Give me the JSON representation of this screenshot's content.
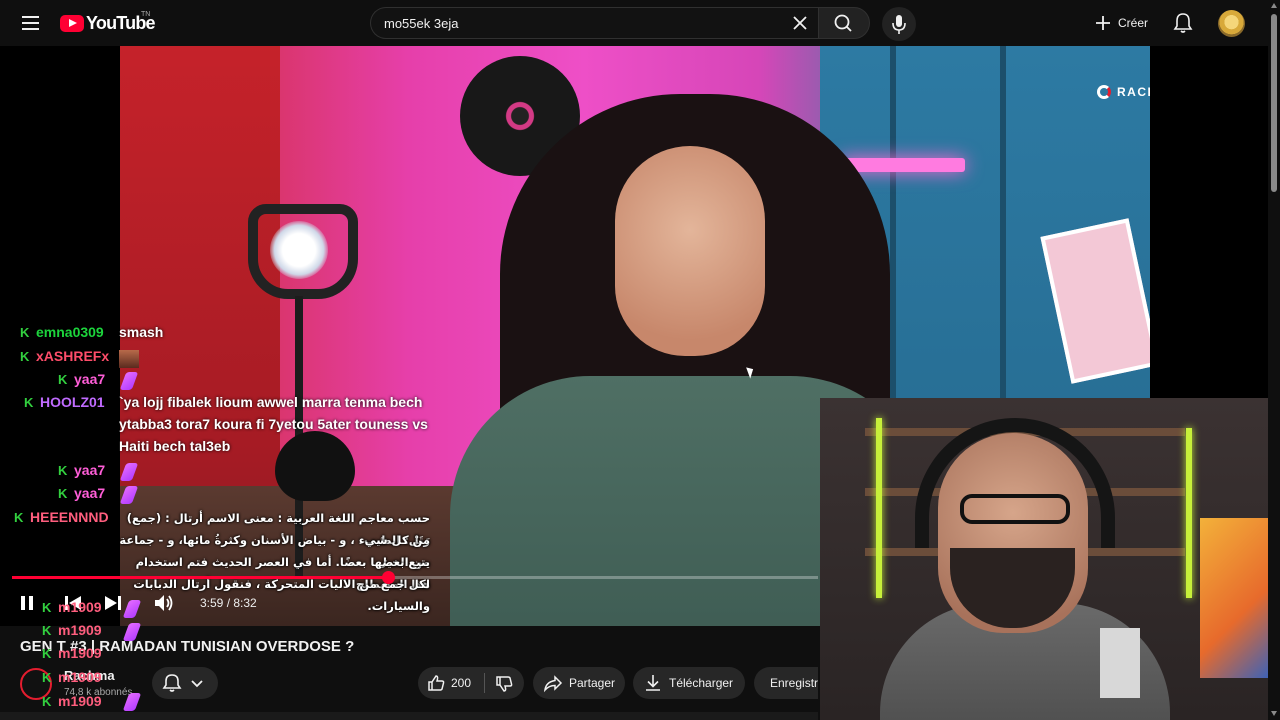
{
  "header": {
    "logo_text": "YouTube",
    "logo_country": "TN",
    "search_value": "mo55ek 3eja",
    "create_label": "Créer"
  },
  "video": {
    "brand_overlay": "RACHMA",
    "current_time": "3:59",
    "duration": "8:32",
    "time_display": "3:59 / 8:32",
    "progress_fraction": 0.467
  },
  "chat": {
    "messages": [
      {
        "user": "emna0309",
        "text": "smash",
        "emote": ""
      },
      {
        "user": "xASHREFx",
        "text": "",
        "emote": "picture"
      },
      {
        "user": "yaa7",
        "text": "",
        "emote": "zap"
      },
      {
        "user": "HOOLZ01",
        "text": "`ya lojj fibalek lioum awwel marra tenma bech",
        "emote": ""
      },
      {
        "user": "",
        "text": "ytabba3 tora7 koura fi 7yetou 5ater touness vs",
        "emote": ""
      },
      {
        "user": "",
        "text": "Haiti bech tal3eb",
        "emote": ""
      },
      {
        "user": "yaa7",
        "text": "",
        "emote": "zap"
      },
      {
        "user": "yaa7",
        "text": "",
        "emote": "zap"
      },
      {
        "user": "HEEENNND",
        "text": "",
        "emote": ""
      },
      {
        "user": "m1909",
        "text": "",
        "emote": "zap"
      },
      {
        "user": "m1909",
        "text": "",
        "emote": "zap"
      },
      {
        "user": "m1909",
        "text": "",
        "emote": "zap"
      },
      {
        "user": "m1909",
        "text": "",
        "emote": "zap"
      },
      {
        "user": "m1909",
        "text": "",
        "emote": "zap"
      }
    ],
    "arabic_lines": [
      "حسب معاجم اللغة العربية : معنى الاسم أرتال : (جمع) رَتَل: الطيب",
      "منْ كل شيء ، و - بياض الأسنان وكثرةُ مائها، و - جماعة من الخيل",
      "يتبع بعضها بعضًا. أما في العصر الحديث فتم استخدام هذا المصطلح",
      "لكل جمع من الآليات المتحركة ، فنقول أرتال الدبابات والسيارات."
    ]
  },
  "info": {
    "title": "GEN T #3 | RAMADAN TUNISIAN OVERDOSE ?",
    "channel_name": "Rachma",
    "channel_subs": "74,8 k abonnés",
    "likes": "200",
    "share_label": "Partager",
    "download_label": "Télécharger",
    "save_label": "Enregistrer"
  },
  "colors": {
    "accent": "#ff0033",
    "chat_username": "#1cd43c",
    "background": "#0f0f0f"
  }
}
